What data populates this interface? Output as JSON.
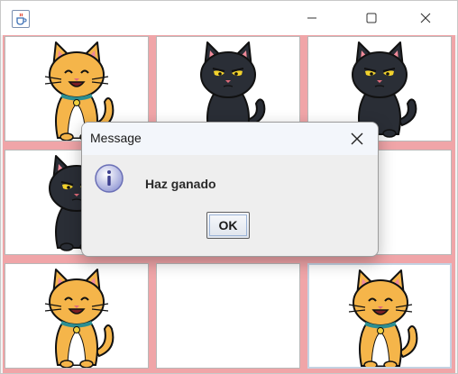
{
  "window": {
    "title": "",
    "icons": {
      "app": "java-cup-icon",
      "minimize": "minimize-icon",
      "maximize": "maximize-icon",
      "close": "close-icon"
    }
  },
  "board": {
    "rows": 3,
    "cols": 3,
    "cells": [
      "orange-cat",
      "black-cat",
      "black-cat",
      "black-cat",
      "empty",
      "empty",
      "orange-cat",
      "empty",
      "orange-cat"
    ],
    "selected_cell": 8,
    "grid_color": "#f0a5a8"
  },
  "dialog": {
    "title": "Message",
    "message": "Haz ganado",
    "ok_label": "OK",
    "icon": "info-icon"
  }
}
